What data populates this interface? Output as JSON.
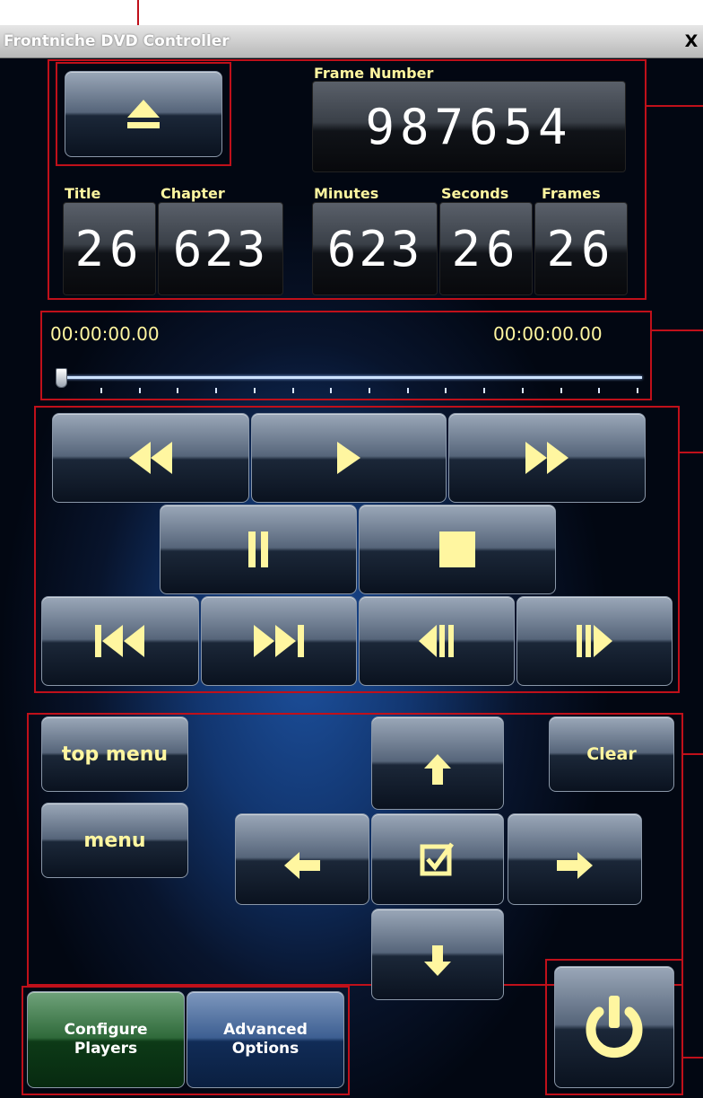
{
  "window": {
    "title": "Frontniche DVD Controller",
    "close_label": "X"
  },
  "eject": {
    "icon": "eject-icon"
  },
  "frame_number": {
    "label": "Frame Number",
    "value": "987654"
  },
  "counters": [
    {
      "label": "Title",
      "value": "26"
    },
    {
      "label": "Chapter",
      "value": "623"
    },
    {
      "label": "Minutes",
      "value": "623"
    },
    {
      "label": "Seconds",
      "value": "26"
    },
    {
      "label": "Frames",
      "value": "26"
    }
  ],
  "timeline": {
    "start_time": "00:00:00.00",
    "end_time": "00:00:00.00",
    "position": 0
  },
  "transport": {
    "row1": [
      "rewind-icon",
      "play-icon",
      "fast-forward-icon"
    ],
    "row2": [
      "pause-icon",
      "stop-icon"
    ],
    "row3": [
      "skip-previous-icon",
      "skip-next-icon",
      "step-back-icon",
      "step-forward-icon"
    ]
  },
  "menu": {
    "top_menu_label": "top menu",
    "menu_label": "menu",
    "clear_label": "Clear"
  },
  "navigation": [
    "up-arrow-icon",
    "left-arrow-icon",
    "select-check-icon",
    "right-arrow-icon",
    "down-arrow-icon"
  ],
  "footer": {
    "configure_label": "Configure Players",
    "advanced_label": "Advanced Options"
  },
  "colors": {
    "accent": "#fff6a0",
    "annotation": "#c0101a",
    "configure": "#1f6a2a",
    "advanced": "#1b3f78"
  }
}
